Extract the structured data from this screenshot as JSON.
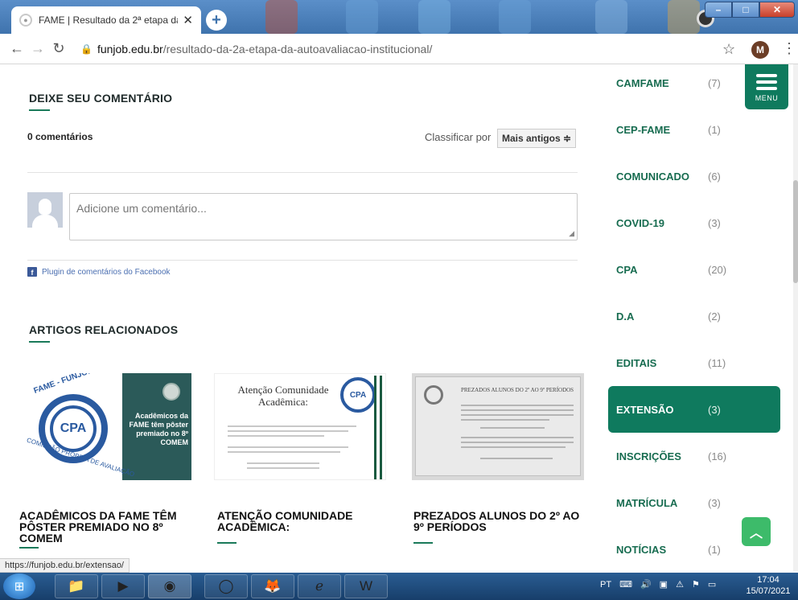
{
  "browser": {
    "tab_title": "FAME | Resultado da 2ª etapa da",
    "close_glyph": "✕",
    "new_tab_glyph": "+",
    "url_host": "funjob.edu.br",
    "url_path": "/resultado-da-2a-etapa-da-autoavaliacao-institucional/",
    "profile_initial": "M"
  },
  "comments": {
    "section_title": "DEIXE SEU COMENTÁRIO",
    "count_label": "0 comentários",
    "sort_label": "Classificar por",
    "sort_value": "Mais antigos ≑",
    "placeholder": "Adicione um comentário...",
    "fb_plugin_label": "Plugin de comentários do Facebook"
  },
  "related": {
    "section_title": "ARTIGOS RELACIONADOS",
    "articles": [
      {
        "title": "ACADÊMICOS DA FAME TÊM PÔSTER PREMIADO NO 8º COMEM",
        "image_caption": "Acadêmicos da FAME têm pôster premiado no 8º COMEM",
        "image_logo_top": "FAME - FUNJOB",
        "image_logo_center": "CPA",
        "image_logo_bottom": "COMISSÃO PRÓPRIA DE AVALIAÇÃO"
      },
      {
        "title": "ATENÇÃO COMUNIDADE ACADÊMICA:",
        "image_heading": "Atenção Comunidade Acadêmica:",
        "image_logo": "CPA"
      },
      {
        "title": "PREZADOS ALUNOS DO 2º AO 9º PERÍODOS",
        "image_heading": "PREZADOS ALUNOS DO 2º AO 9º PERÍODOS"
      }
    ]
  },
  "sidebar": {
    "menu_label": "MENU",
    "categories": [
      {
        "name": "CAMFAME",
        "count": "(7)"
      },
      {
        "name": "CEP-FAME",
        "count": "(1)"
      },
      {
        "name": "COMUNICADO",
        "count": "(6)"
      },
      {
        "name": "COVID-19",
        "count": "(3)"
      },
      {
        "name": "CPA",
        "count": "(20)"
      },
      {
        "name": "D.A",
        "count": "(2)"
      },
      {
        "name": "EDITAIS",
        "count": "(11)"
      },
      {
        "name": "EXTENSÃO",
        "count": "(3)"
      },
      {
        "name": "INSCRIÇÕES",
        "count": "(16)"
      },
      {
        "name": "MATRÍCULA",
        "count": "(3)"
      },
      {
        "name": "NOTÍCIAS",
        "count": "(1)"
      }
    ],
    "active_category": "EXTENSÃO"
  },
  "status_bar": {
    "hover_url": "https://funjob.edu.br/extensao/"
  },
  "taskbar": {
    "language": "PT",
    "time": "17:04",
    "date": "15/07/2021"
  },
  "colors": {
    "brand_green": "#0f7a5e",
    "link_green": "#176c50",
    "scroll_top": "#3dbb6a"
  }
}
